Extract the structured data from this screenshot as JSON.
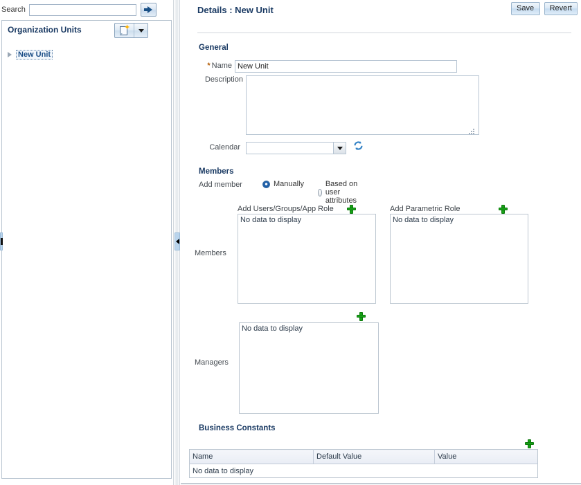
{
  "left_panel": {
    "search": {
      "label": "Search",
      "value": "",
      "placeholder": "",
      "go_icon": "arrow-right-icon"
    },
    "org_units": {
      "title": "Organization Units",
      "toolbar": {
        "new_icon": "new-document-icon",
        "dropdown_icon": "chevron-down-icon",
        "delete_icon": "delete-x-icon"
      },
      "tree": [
        {
          "label": "New Unit",
          "selected": true,
          "expanded": false
        }
      ]
    }
  },
  "splitter": {
    "right_handle_icon": "chevron-left-icon",
    "left_handle_icon": "splitter-grip-icon"
  },
  "details": {
    "title": "Details : New Unit",
    "actions": {
      "save_label": "Save",
      "revert_label": "Revert"
    },
    "general": {
      "section_label": "General",
      "name_label": "Name",
      "name_required_marker": "*",
      "name_value": "New Unit",
      "name_placeholder": "",
      "description_label": "Description",
      "description_value": "",
      "description_placeholder": "",
      "calendar_label": "Calendar",
      "calendar_value": "",
      "calendar_refresh_icon": "refresh-icon",
      "calendar_dropdown_icon": "chevron-down-icon"
    },
    "members": {
      "section_label": "Members",
      "add_member_label": "Add member",
      "options": [
        {
          "label": "Manually",
          "selected": true
        },
        {
          "label": "Based on user attributes",
          "selected": false
        }
      ],
      "members_row_label": "Members",
      "users_list": {
        "header": "Add Users/Groups/App Role",
        "add_icon": "plus-icon",
        "remove_icon": "delete-x-icon",
        "empty_text": "No data to display",
        "rows": []
      },
      "parametric_list": {
        "header": "Add Parametric Role",
        "add_icon": "plus-icon",
        "remove_icon": "delete-x-icon",
        "empty_text": "No data to display",
        "rows": []
      },
      "managers_row_label": "Managers",
      "managers_list": {
        "add_icon": "plus-icon",
        "remove_icon": "delete-x-icon",
        "empty_text": "No data to display",
        "rows": []
      }
    },
    "business_constants": {
      "section_label": "Business Constants",
      "add_icon": "plus-icon",
      "remove_icon": "delete-x-icon-disabled",
      "columns": [
        "Name",
        "Default Value",
        "Value"
      ],
      "empty_text": "No data to display",
      "rows": []
    }
  },
  "colors": {
    "header_blue": "#1a3a63",
    "link_blue": "#1a4d86",
    "accent_green": "#17a117",
    "accent_red": "#cc2222",
    "panel_border": "#b8c4d0"
  }
}
